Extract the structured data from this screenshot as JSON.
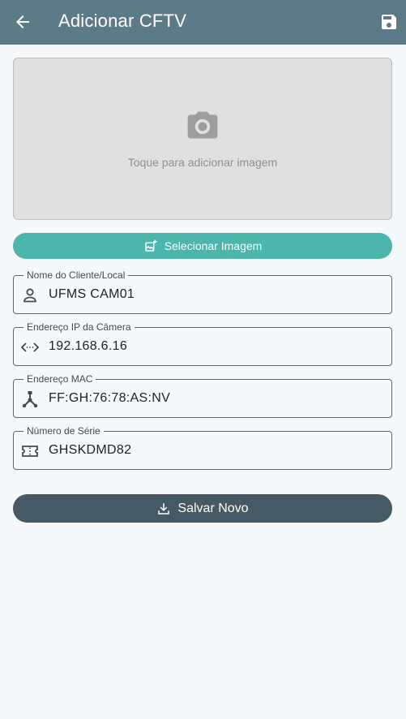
{
  "appbar": {
    "title": "Adicionar CFTV",
    "back_icon": "arrow-left-icon",
    "save_icon": "floppy-disk-icon",
    "color": "#5d7a88"
  },
  "image_picker": {
    "hint": "Toque para adicionar imagem",
    "icon": "camera-icon"
  },
  "select_image_button": {
    "label": "Selecionar Imagem",
    "icon": "add-photo-icon",
    "color": "#4db6ac"
  },
  "fields": {
    "client": {
      "label": "Nome do Cliente/Local",
      "value": "UFMS CAM01",
      "icon": "person-icon"
    },
    "ip": {
      "label": "Endereço IP da Câmera",
      "value": "192.168.6.16",
      "icon": "settings-ethernet-icon"
    },
    "mac": {
      "label": "Endereço MAC",
      "value": "FF:GH:76:78:AS:NV",
      "icon": "device-hub-icon"
    },
    "serial": {
      "label": "Número de Série",
      "value": "GHSKDMD82",
      "icon": "ticket-icon"
    }
  },
  "save_button": {
    "label": "Salvar Novo",
    "icon": "download-icon",
    "color": "#455a64"
  }
}
